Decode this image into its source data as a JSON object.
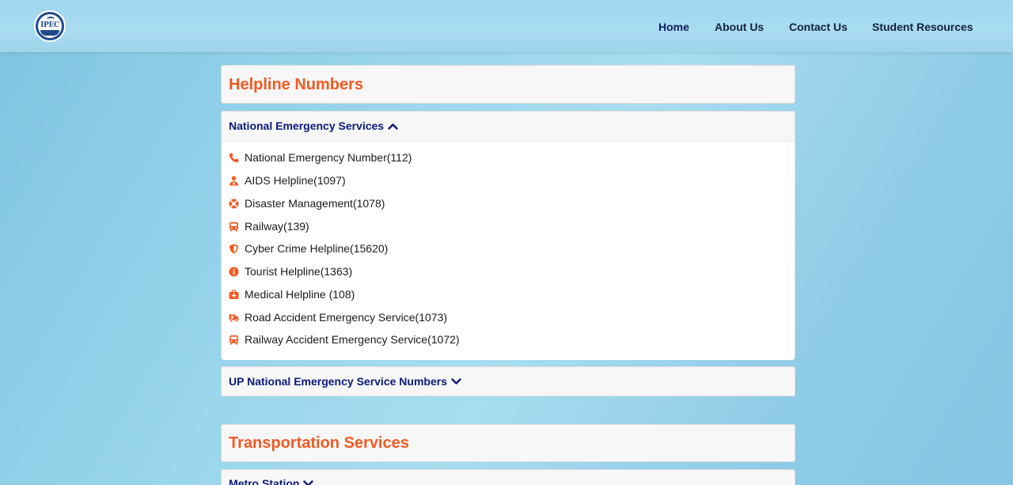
{
  "nav": {
    "logo_text": "IPEC",
    "links": [
      "Home",
      "About Us",
      "Contact Us",
      "Student Resources"
    ]
  },
  "helpline": {
    "title": "Helpline Numbers",
    "national": {
      "header": "National Emergency Services",
      "items": [
        {
          "label": "National Emergency Number(112)",
          "icon": "phone-icon"
        },
        {
          "label": "AIDS Helpline(1097)",
          "icon": "user-doctor-icon"
        },
        {
          "label": "Disaster Management(1078)",
          "icon": "life-ring-icon"
        },
        {
          "label": "Railway(139)",
          "icon": "train-icon"
        },
        {
          "label": "Cyber Crime Helpline(15620)",
          "icon": "shield-icon"
        },
        {
          "label": "Tourist Helpline(1363)",
          "icon": "info-icon"
        },
        {
          "label": "Medical Helpline (108)",
          "icon": "medical-kit-icon"
        },
        {
          "label": "Road Accident Emergency Service(1073)",
          "icon": "ambulance-icon"
        },
        {
          "label": "Railway Accident Emergency Service(1072)",
          "icon": "train-icon"
        }
      ]
    },
    "up": {
      "header": "UP National Emergency Service Numbers"
    }
  },
  "transport": {
    "title": "Transportation Services",
    "metro": {
      "header": "Metro Station"
    }
  },
  "colors": {
    "accent": "#f15a22",
    "header_text": "#0a1a7a",
    "nav_text": "#14213d"
  }
}
